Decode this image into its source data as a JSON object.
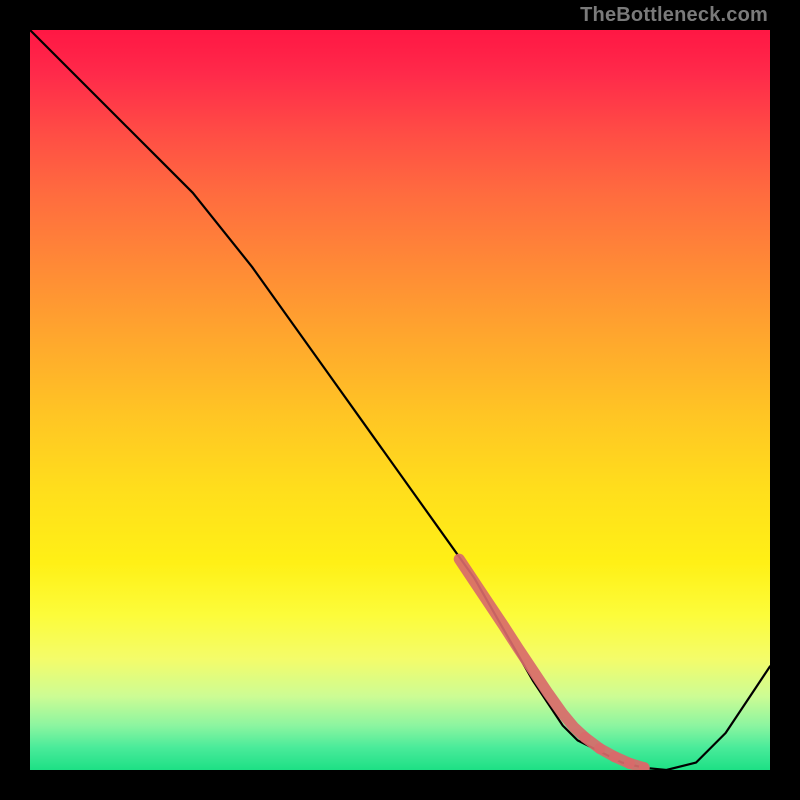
{
  "watermark": "TheBottleneck.com",
  "colors": {
    "frame": "#000000",
    "curve": "#000000",
    "marker": "#d86a6a",
    "gradient_top": "#ff1744",
    "gradient_bottom": "#1de085",
    "watermark_text": "#7a7a7a"
  },
  "chart_data": {
    "type": "line",
    "title": "",
    "xlabel": "",
    "ylabel": "",
    "xlim": [
      0,
      100
    ],
    "ylim": [
      0,
      100
    ],
    "grid": false,
    "legend": false,
    "series": [
      {
        "name": "bottleneck-curve",
        "x": [
          0,
          5,
          10,
          15,
          18,
          22,
          26,
          30,
          35,
          40,
          45,
          50,
          55,
          60,
          64,
          68,
          72,
          74,
          76,
          78,
          80,
          83,
          86,
          90,
          94,
          98,
          100
        ],
        "y": [
          100,
          95,
          90,
          85,
          82,
          78,
          73,
          68,
          61,
          54,
          47,
          40,
          33,
          26,
          19,
          12,
          6,
          4,
          3,
          2,
          1,
          0.3,
          0,
          1,
          5,
          11,
          14
        ]
      }
    ],
    "markers": {
      "name": "highlight-segment",
      "x": [
        58,
        60,
        62,
        64,
        66,
        68,
        70,
        72,
        73.5,
        75,
        77,
        79,
        81,
        83
      ],
      "y": [
        28.5,
        25.5,
        22.5,
        19.5,
        16.4,
        13.4,
        10.4,
        7.6,
        5.8,
        4.4,
        2.9,
        1.8,
        0.9,
        0.3
      ],
      "style": "scatter"
    }
  }
}
